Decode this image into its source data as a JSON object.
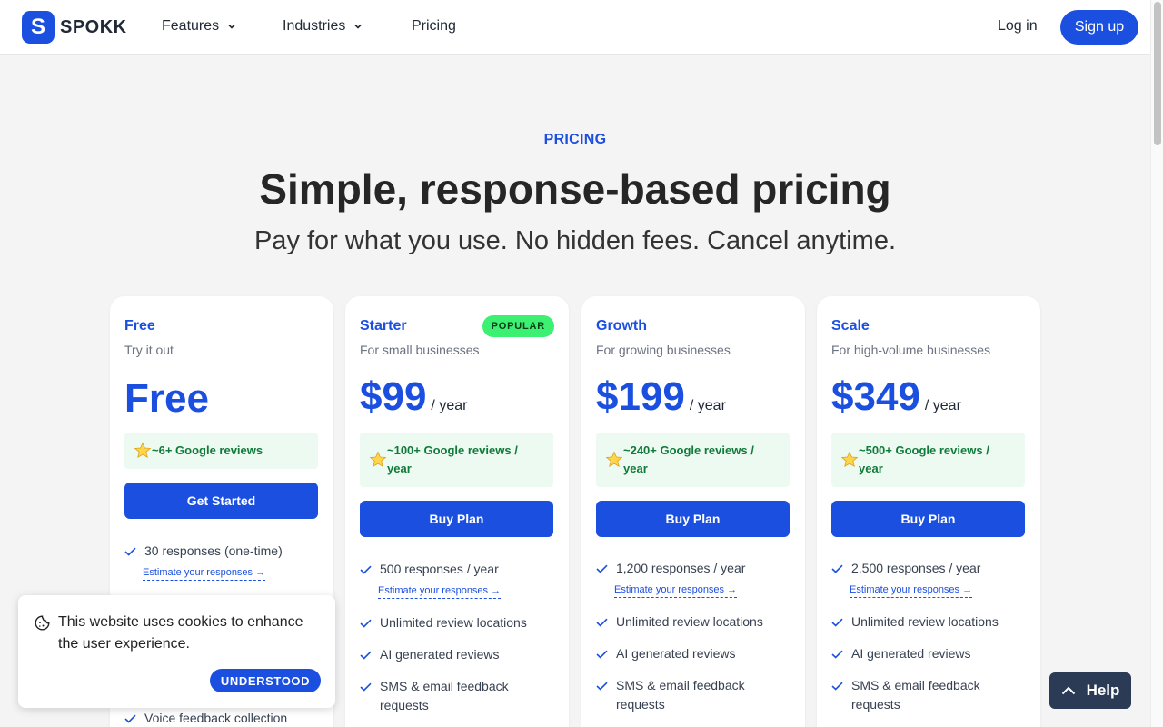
{
  "header": {
    "logo_letter": "S",
    "logo_text": "SPOKK",
    "nav": [
      "Features",
      "Industries",
      "Pricing"
    ],
    "login": "Log in",
    "signup": "Sign up"
  },
  "hero": {
    "eyebrow": "PRICING",
    "title": "Simple, response-based pricing",
    "subtitle": "Pay for what you use. No hidden fees. Cancel anytime."
  },
  "plans": [
    {
      "name": "Free",
      "desc": "Try it out",
      "price": "Free",
      "reviews": "~6+ Google reviews",
      "cta": "Get Started",
      "responses": "30 responses (one-time)",
      "estimate": "Estimate your responses →",
      "features": [
        "Voice feedback collection"
      ]
    },
    {
      "name": "Starter",
      "badge": "POPULAR",
      "desc": "For small businesses",
      "price": "$99",
      "period": "/ year",
      "reviews_line1": "~100+ Google reviews /",
      "reviews_line2": "year",
      "cta": "Buy Plan",
      "responses": "500 responses / year",
      "estimate": "Estimate your responses →",
      "features": [
        "Unlimited review locations",
        "AI generated reviews",
        "SMS & email feedback",
        "requests"
      ]
    },
    {
      "name": "Growth",
      "desc": "For growing businesses",
      "price": "$199",
      "period": "/ year",
      "reviews_line1": "~240+ Google reviews /",
      "reviews_line2": "year",
      "cta": "Buy Plan",
      "responses": "1,200 responses / year",
      "estimate": "Estimate your responses →",
      "features": [
        "Unlimited review locations",
        "AI generated reviews",
        "SMS & email feedback",
        "requests"
      ]
    },
    {
      "name": "Scale",
      "desc": "For high-volume businesses",
      "price": "$349",
      "period": "/ year",
      "reviews_line1": "~500+ Google reviews /",
      "reviews_line2": "year",
      "cta": "Buy Plan",
      "responses": "2,500 responses / year",
      "estimate": "Estimate your responses →",
      "features": [
        "Unlimited review locations",
        "AI generated reviews",
        "SMS & email feedback",
        "requests"
      ]
    }
  ],
  "cookie": {
    "text": "This website uses cookies to enhance the user experience.",
    "button": "UNDERSTOOD"
  },
  "help": {
    "label": "Help"
  },
  "colors": {
    "accent": "#1b4fe0",
    "badge": "#3cf072",
    "reviews_bg": "#ecfaf1",
    "reviews_text": "#117a3a",
    "help_bg": "#2b3a55"
  },
  "icons": [
    "chevron-down-icon",
    "star-icon",
    "check-icon",
    "cookie-icon",
    "chevron-up-icon"
  ]
}
